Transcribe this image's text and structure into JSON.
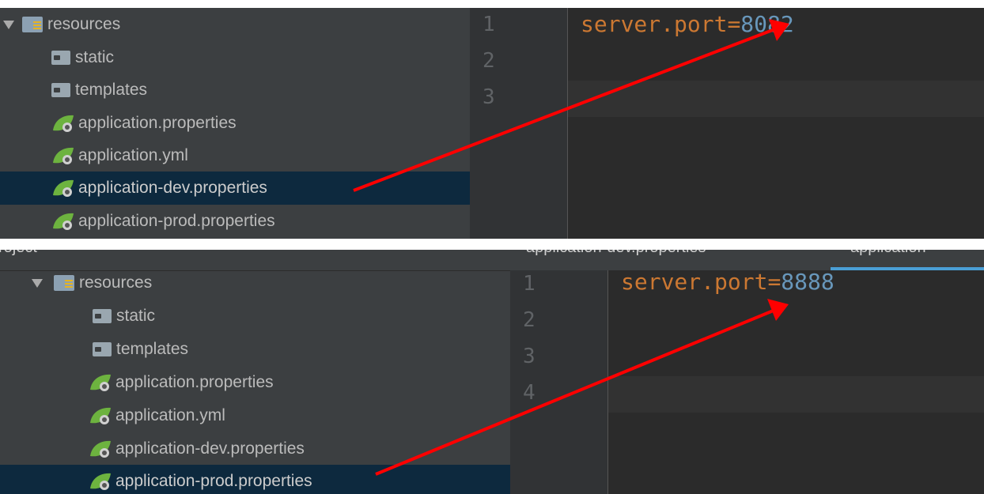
{
  "top_panel": {
    "tree": {
      "root_label": "resources",
      "items": [
        {
          "label": "static"
        },
        {
          "label": "templates"
        },
        {
          "label": "application.properties"
        },
        {
          "label": "application.yml"
        },
        {
          "label": "application-dev.properties",
          "selected": true
        },
        {
          "label": "application-prod.properties"
        }
      ]
    },
    "editor": {
      "line_numbers": [
        "1",
        "2",
        "3"
      ],
      "code": {
        "key": "server.port",
        "eq": "=",
        "value": "8082"
      }
    }
  },
  "bottom_panel": {
    "header": {
      "project_label": "roject",
      "tabs": [
        "application-dev.properties",
        "application"
      ]
    },
    "tree": {
      "root_label": "resources",
      "items": [
        {
          "label": "static"
        },
        {
          "label": "templates"
        },
        {
          "label": "application.properties"
        },
        {
          "label": "application.yml"
        },
        {
          "label": "application-dev.properties"
        },
        {
          "label": "application-prod.properties",
          "selected": true
        }
      ]
    },
    "editor": {
      "line_numbers": [
        "1",
        "2",
        "3",
        "4"
      ],
      "code": {
        "key": "server.port",
        "eq": "=",
        "value": "8888"
      }
    }
  },
  "colors": {
    "tree_bg": "#3c3f41",
    "editor_bg": "#2b2b2b",
    "selection": "#0d293e",
    "key": "#cc7832",
    "value": "#6897bb",
    "arrow": "#ff0000"
  },
  "icons": [
    "folder-icon",
    "resources-folder-icon",
    "spring-leaf-icon",
    "expand-triangle-icon"
  ]
}
